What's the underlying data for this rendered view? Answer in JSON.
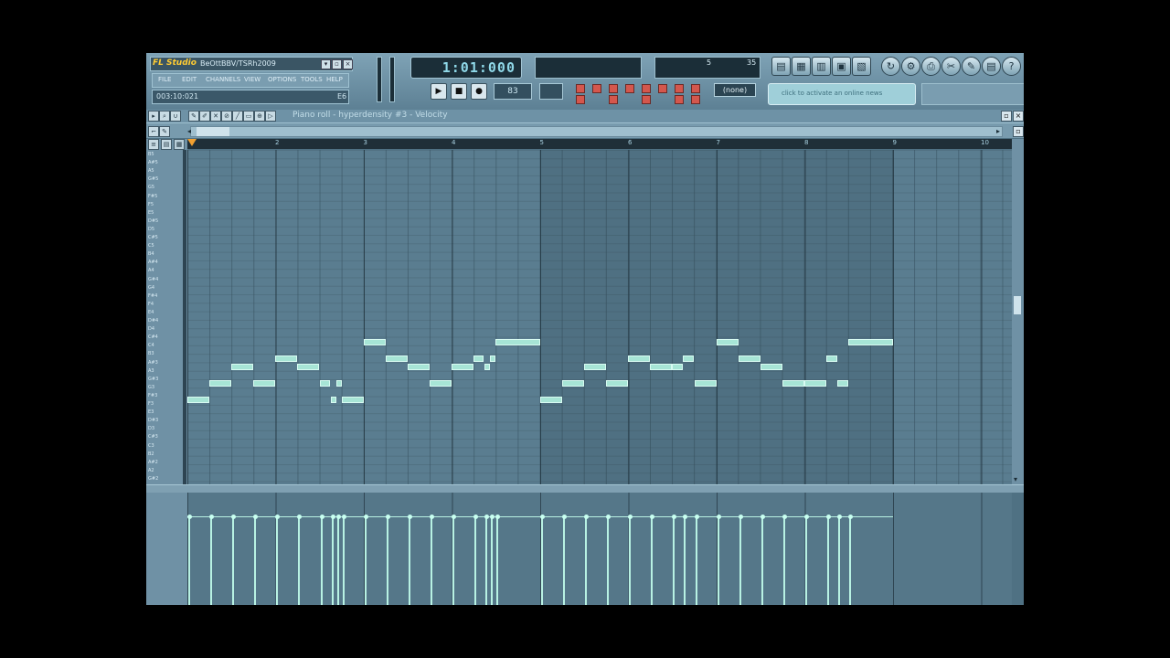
{
  "app": {
    "logo": "FL Studio",
    "song_title": "BeOttBBV/TSRh2009",
    "hint_text": "003:10:021",
    "hint_right": "E6",
    "lcd_time": "1:01:000",
    "pattern": "83",
    "none_label": "(none)",
    "hint_panel": "click to activate an online news",
    "menu_items": [
      "FILE",
      "EDIT",
      "CHANNELS",
      "VIEW",
      "OPTIONS",
      "TOOLS",
      "HELP"
    ],
    "cpu_value": "5",
    "poly_value": "35"
  },
  "piano_roll": {
    "caption": "Piano roll - hyperdensity #3 - Velocity",
    "bar_labels": [
      "2",
      "3",
      "4",
      "5",
      "6",
      "7",
      "8",
      "9",
      "10"
    ],
    "key_labels": [
      "B5",
      "A#5",
      "A5",
      "G#5",
      "G5",
      "F#5",
      "F5",
      "E5",
      "D#5",
      "D5",
      "C#5",
      "C5",
      "B4",
      "A#4",
      "A4",
      "G#4",
      "G4",
      "F#4",
      "F4",
      "E4",
      "D#4",
      "D4",
      "C#4",
      "C4",
      "B3",
      "A#3",
      "A3",
      "G#3",
      "G3",
      "F#3",
      "F3",
      "E3",
      "D#3",
      "D3",
      "C#3",
      "C3",
      "B2",
      "A#2",
      "A2",
      "G#2"
    ]
  },
  "colors": {
    "note": "#a7e5d6",
    "background": "#4f7183"
  }
}
